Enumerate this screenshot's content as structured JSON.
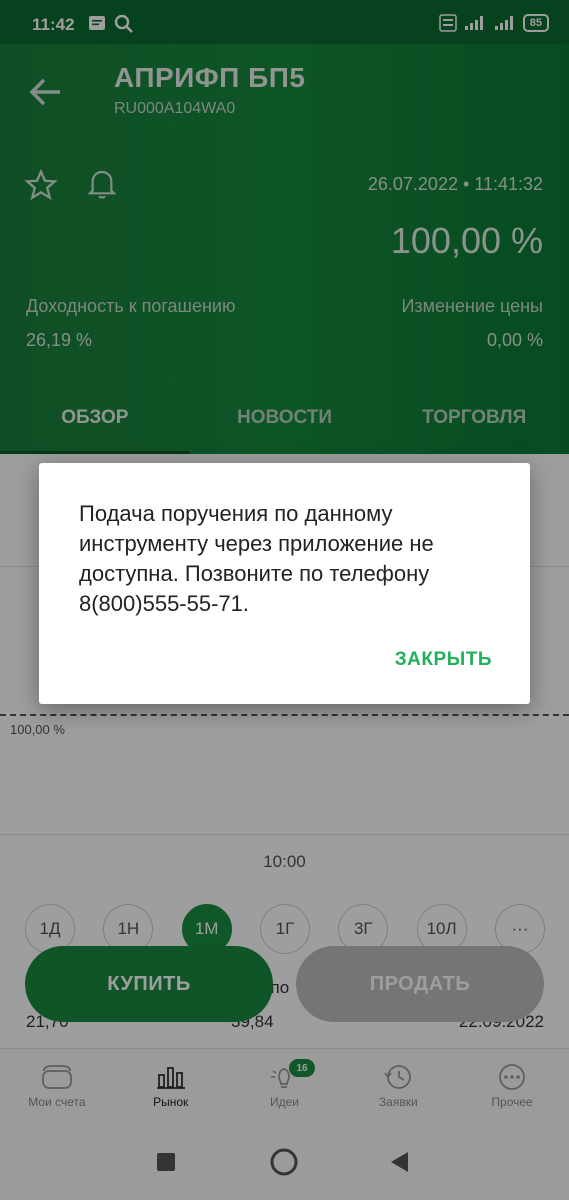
{
  "status_bar": {
    "time": "11:42",
    "battery": "85"
  },
  "header": {
    "title": "АПРИФП БП5",
    "isin": "RU000A104WA0",
    "datetime": "26.07.2022 • 11:41:32",
    "price": "100,00  %",
    "ytm_label": "Доходность к погашению",
    "ytm_value": "26,19  %",
    "change_label": "Изменение цены",
    "change_value": "0,00  %"
  },
  "tabs": [
    {
      "label": "ОБЗОР",
      "active": true
    },
    {
      "label": "НОВОСТИ",
      "active": false
    },
    {
      "label": "ТОРГОВЛЯ",
      "active": false
    }
  ],
  "chart": {
    "level_label": "100,00  %",
    "time_label": "10:00"
  },
  "periods": [
    "1Д",
    "1Н",
    "1М",
    "1Г",
    "3Г",
    "10Л",
    "···"
  ],
  "stats": {
    "left": "21,70",
    "mid": "39,84",
    "right": "22.09.2022",
    "coupon_fragment": "упо"
  },
  "actions": {
    "buy": "КУПИТЬ",
    "sell": "ПРОДАТЬ"
  },
  "bottom_nav": [
    {
      "label": "Мои счета",
      "icon": "wallet-icon"
    },
    {
      "label": "Рынок",
      "icon": "market-icon",
      "active": true
    },
    {
      "label": "Идеи",
      "icon": "lightbulb-icon",
      "badge": "16"
    },
    {
      "label": "Заявки",
      "icon": "history-icon"
    },
    {
      "label": "Прочее",
      "icon": "more-icon"
    }
  ],
  "dialog": {
    "message": "Подача поручения по данному инструменту через приложение не доступна. Позвоните по телефону 8(800)555-55-71.",
    "close_label": "ЗАКРЫТЬ"
  },
  "colors": {
    "brand_green": "#1b8a42",
    "accent_green": "#22b05a"
  }
}
